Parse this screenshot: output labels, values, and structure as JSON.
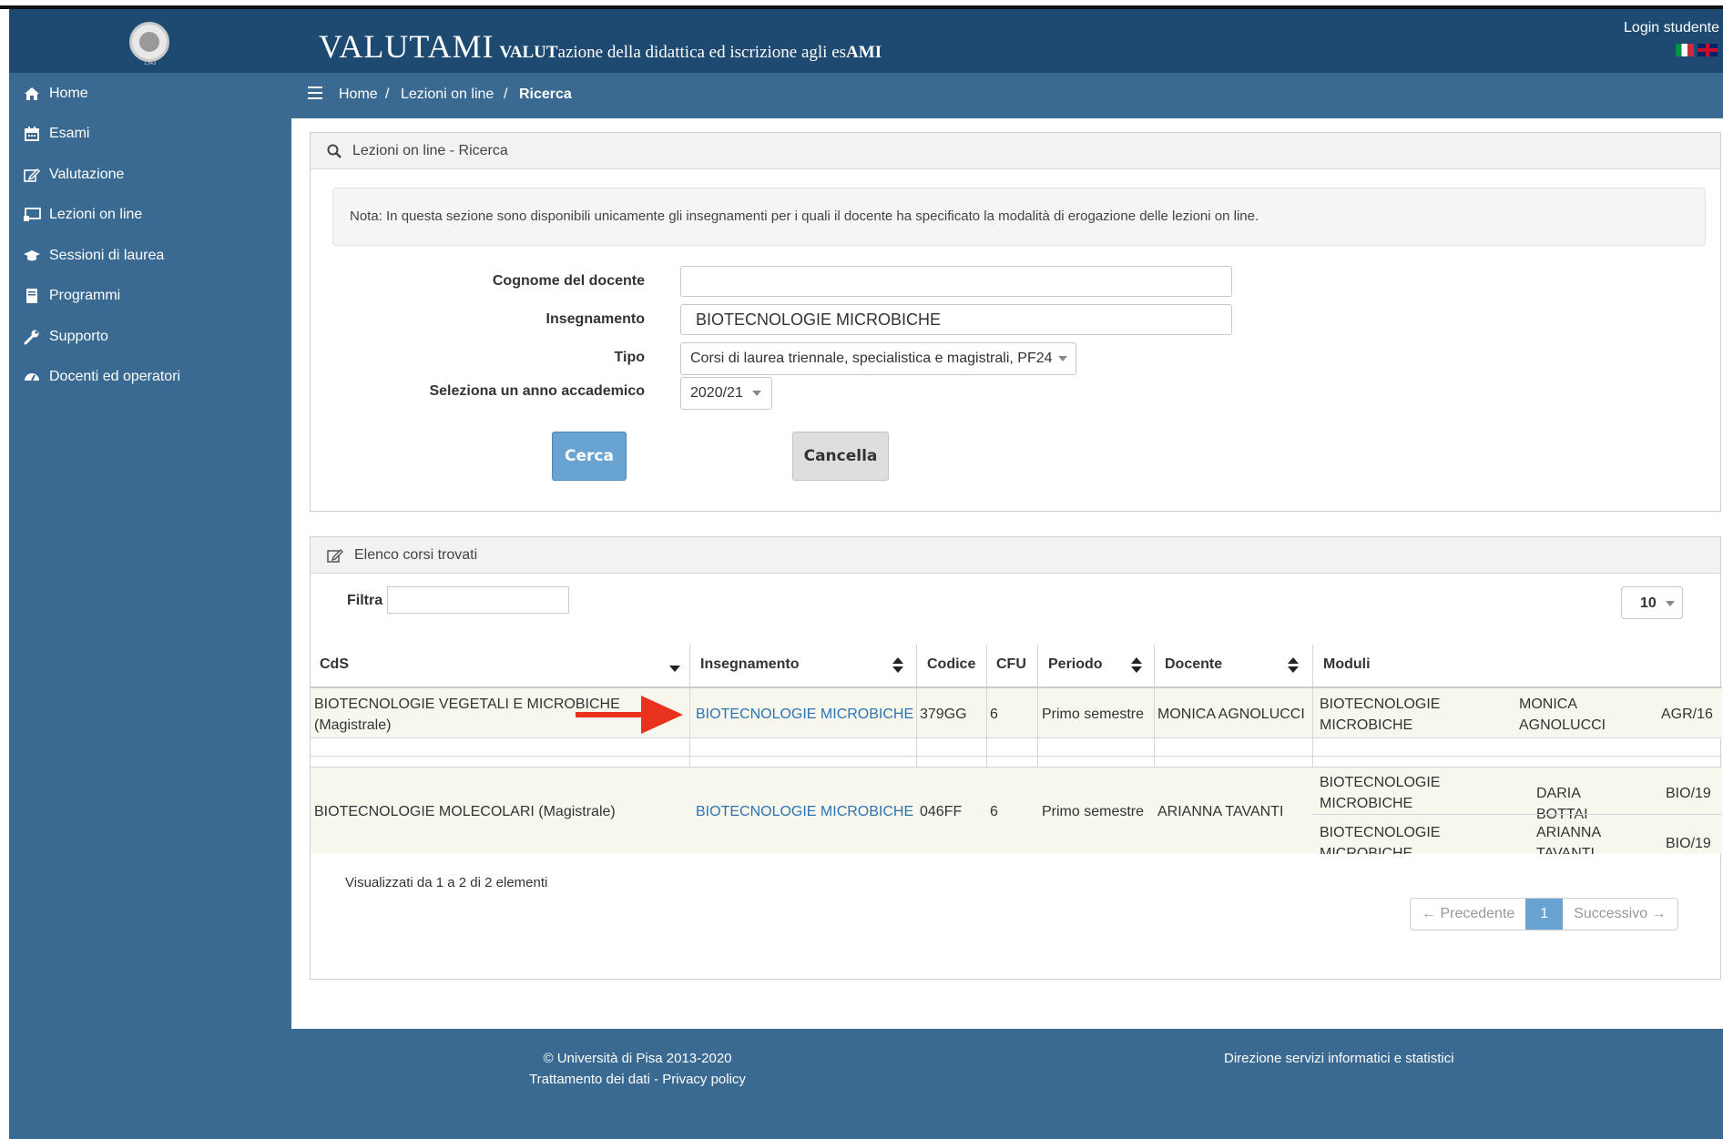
{
  "header": {
    "brand_big": "VALUTAMI",
    "brand_small_html_parts": [
      "VALUT",
      "azione della didattica ed iscrizione agli es",
      "AMI"
    ],
    "login": "Login studente",
    "logo_year": "1343"
  },
  "sidebar": {
    "items": [
      {
        "label": "Home",
        "icon": "home-icon"
      },
      {
        "label": "Esami",
        "icon": "calendar-icon"
      },
      {
        "label": "Valutazione",
        "icon": "edit-icon"
      },
      {
        "label": "Lezioni on line",
        "icon": "screen-icon"
      },
      {
        "label": "Sessioni di laurea",
        "icon": "graduation-cap-icon"
      },
      {
        "label": "Programmi",
        "icon": "book-icon"
      },
      {
        "label": "Supporto",
        "icon": "wrench-icon"
      },
      {
        "label": "Docenti ed operatori",
        "icon": "dashboard-icon"
      }
    ]
  },
  "breadcrumb": {
    "items": [
      "Home",
      "Lezioni on line",
      "Ricerca"
    ],
    "separator": "/"
  },
  "search_panel": {
    "title": "Lezioni on line - Ricerca",
    "note": "Nota: In questa sezione sono disponibili unicamente gli insegnamenti per i quali il docente ha specificato la modalità di erogazione delle lezioni on line.",
    "fields": {
      "cognome_label": "Cognome del docente",
      "cognome_value": "",
      "insegnamento_label": "Insegnamento",
      "insegnamento_value": "BIOTECNOLOGIE MICROBICHE",
      "tipo_label": "Tipo",
      "tipo_value": "Corsi di laurea triennale, specialistica e magistrali, PF24",
      "anno_label": "Seleziona un anno accademico",
      "anno_value": "2020/21"
    },
    "buttons": {
      "search": "Cerca",
      "cancel": "Cancella"
    }
  },
  "results_panel": {
    "title": "Elenco corsi trovati",
    "filter_label": "Filtra",
    "page_size": "10",
    "columns": [
      "CdS",
      "Insegnamento",
      "Codice",
      "CFU",
      "Periodo",
      "Docente",
      "Moduli"
    ],
    "rows": [
      {
        "cds": "BIOTECNOLOGIE VEGETALI E MICROBICHE (Magistrale)",
        "insegnamento": "BIOTECNOLOGIE MICROBICHE",
        "codice": "379GG",
        "cfu": "6",
        "periodo": "Primo semestre",
        "docente": "MONICA AGNOLUCCI",
        "moduli": [
          {
            "nome": "BIOTECNOLOGIE MICROBICHE",
            "docente": "MONICA AGNOLUCCI",
            "ssd": "AGR/16"
          }
        ]
      },
      {
        "cds": "BIOTECNOLOGIE MOLECOLARI (Magistrale)",
        "insegnamento": "BIOTECNOLOGIE MICROBICHE",
        "codice": "046FF",
        "cfu": "6",
        "periodo": "Primo semestre",
        "docente": "ARIANNA TAVANTI",
        "moduli": [
          {
            "nome": "BIOTECNOLOGIE MICROBICHE",
            "docente": "DARIA BOTTAI",
            "ssd": "BIO/19"
          },
          {
            "nome": "BIOTECNOLOGIE MICROBICHE",
            "docente": "ARIANNA TAVANTI",
            "ssd": "BIO/19"
          }
        ]
      }
    ],
    "info": "Visualizzati da 1 a 2 di 2 elementi",
    "pager": {
      "prev": "← Precedente",
      "current": "1",
      "next": "Successivo →"
    }
  },
  "footer": {
    "copyright": "© Università di Pisa 2013-2020",
    "privacy": "Trattamento dei dati - Privacy policy",
    "right": "Direzione servizi informatici e statistici"
  },
  "colors": {
    "header": "#1e4a72",
    "sidebar": "#3a6a92",
    "link": "#2d73b4",
    "primary_button": "#69a3d2",
    "annotation_arrow": "#e8321e"
  }
}
